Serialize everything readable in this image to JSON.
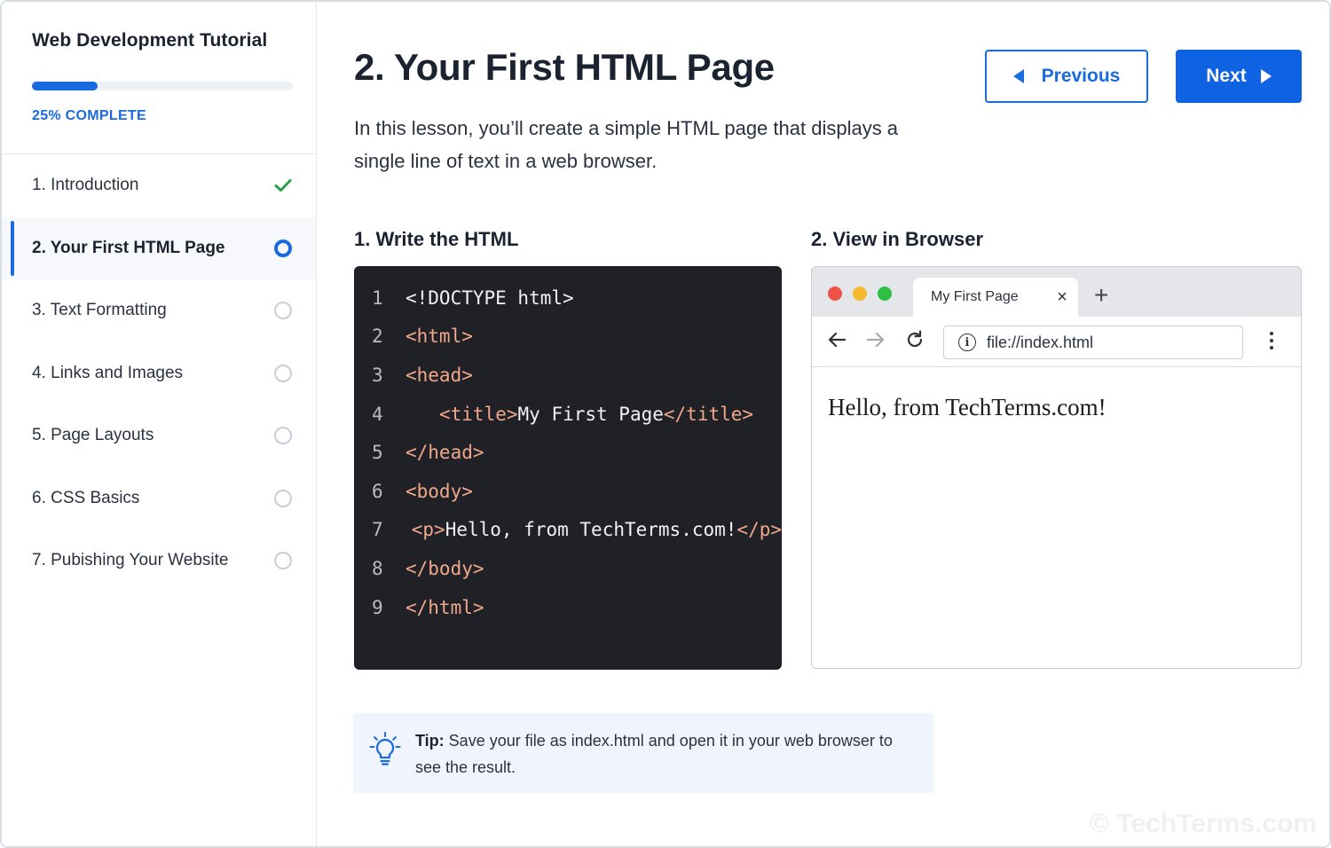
{
  "sidebar": {
    "title": "Web Development Tutorial",
    "progress": 0.25,
    "progress_label": "25% COMPLETE",
    "lessons": [
      {
        "label": "1.  Introduction",
        "status": "complete"
      },
      {
        "label": "2.  Your First HTML Page",
        "status": "active"
      },
      {
        "label": "3.  Text Formatting",
        "status": "incomplete"
      },
      {
        "label": "4.  Links and Images",
        "status": "incomplete"
      },
      {
        "label": "5.  Page Layouts",
        "status": "incomplete"
      },
      {
        "label": "6.  CSS Basics",
        "status": "incomplete"
      },
      {
        "label": "7.  Pubishing Your Website",
        "status": "incomplete"
      }
    ]
  },
  "main": {
    "title": "2. Your First HTML Page",
    "intro": "In this lesson, you’ll create a simple HTML page that displays a single line of text in a web browser.",
    "previous_label": "Previous",
    "next_label": "Next",
    "step1_title": "1. Write the HTML",
    "step2_title": "2.  View in Browser"
  },
  "code": {
    "line_numbers": [
      "1",
      "2",
      "3",
      "4",
      "5",
      "6",
      "7",
      "8",
      "9"
    ],
    "lines": {
      "l1": "<!DOCTYPE html>",
      "l2_tag": "<html>",
      "l3_tag": "<head>",
      "l4_open": "<title>",
      "l4_text": "My First Page",
      "l4_close": "</title>",
      "l5_tag": "</head>",
      "l6_tag": "<body>",
      "l7_open": "<p>",
      "l7_text": "Hello, from TechTerms.com!",
      "l7_close": "</p>",
      "l8_tag": "</body>",
      "l9_tag": "</html>"
    }
  },
  "browser": {
    "tab_title": "My First Page",
    "tab_close": "×",
    "new_tab": "+",
    "url": "file://index.html",
    "content": "Hello, from TechTerms.com!"
  },
  "tip": {
    "label": "Tip:",
    "text": " Save your file as index.html and open it in your web browser to see the result."
  },
  "watermark": "© TechTerms.com",
  "colors": {
    "accent": "#1a6be0",
    "check": "#2e9e4a",
    "code_bg": "#1f2126",
    "code_tag": "#f0a78a",
    "tip_bg": "#f0f5fd"
  },
  "icons": {
    "complete": "check-icon",
    "active": "active-ring-icon",
    "incomplete": "empty-ring-icon",
    "tip": "lightbulb-icon"
  }
}
